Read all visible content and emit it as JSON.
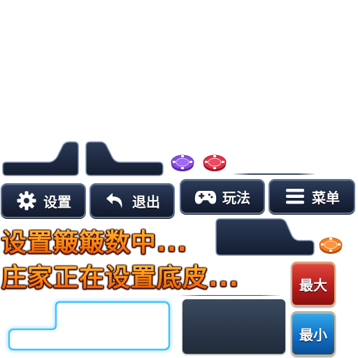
{
  "menu": {
    "settings_label": "设置",
    "exit_label": "退出",
    "rules_label": "玩法",
    "menu_label": "菜单"
  },
  "status": {
    "setting_hui_hui": "设置簸簸数中...",
    "banker_setting_base": "庄家正在设置底皮..."
  },
  "bet": {
    "max_label": "最大",
    "min_label": "最小"
  },
  "icons": {
    "settings": "gear-icon",
    "exit": "return-arrow-icon",
    "rules": "gamepad-icon",
    "menu": "hamburger-icon"
  },
  "colors": {
    "chip_purple": "#8a4fe0",
    "chip_red": "#e0334a",
    "chip_orange": "#f47f25",
    "status_orange": "#ff8a14",
    "max_red": "#b81e1e",
    "min_blue": "#1170c8"
  }
}
